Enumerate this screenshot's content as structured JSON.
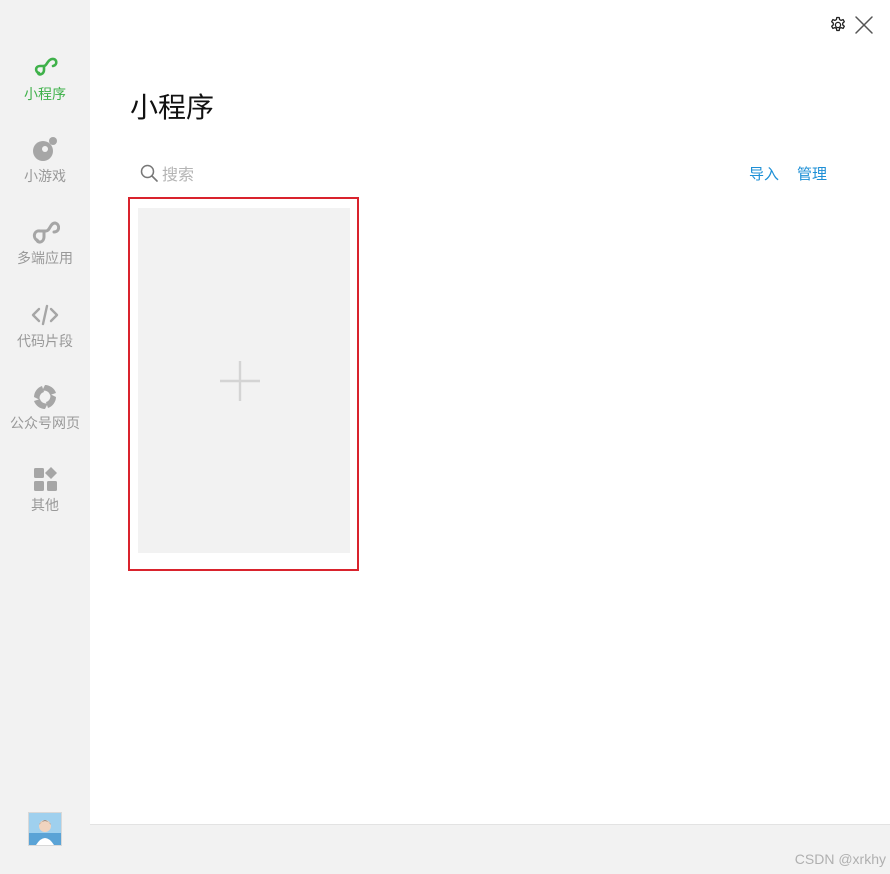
{
  "sidebar": {
    "items": [
      {
        "label": "小程序",
        "icon": "mini-program-icon",
        "active": true
      },
      {
        "label": "小游戏",
        "icon": "mini-game-icon",
        "active": false
      },
      {
        "label": "多端应用",
        "icon": "multi-platform-icon",
        "active": false
      },
      {
        "label": "代码片段",
        "icon": "code-icon",
        "active": false
      },
      {
        "label": "公众号网页",
        "icon": "official-account-icon",
        "active": false
      },
      {
        "label": "其他",
        "icon": "grid-icon",
        "active": false
      }
    ],
    "accent_color": "#3fb14a",
    "inactive_color": "#999999"
  },
  "header": {
    "title": "小程序"
  },
  "search": {
    "placeholder": "搜索",
    "value": ""
  },
  "actions": {
    "import_label": "导入",
    "manage_label": "管理",
    "link_color": "#1d8fd6"
  },
  "highlight_color": "#d9232d",
  "watermark": "CSDN @xrkhy"
}
